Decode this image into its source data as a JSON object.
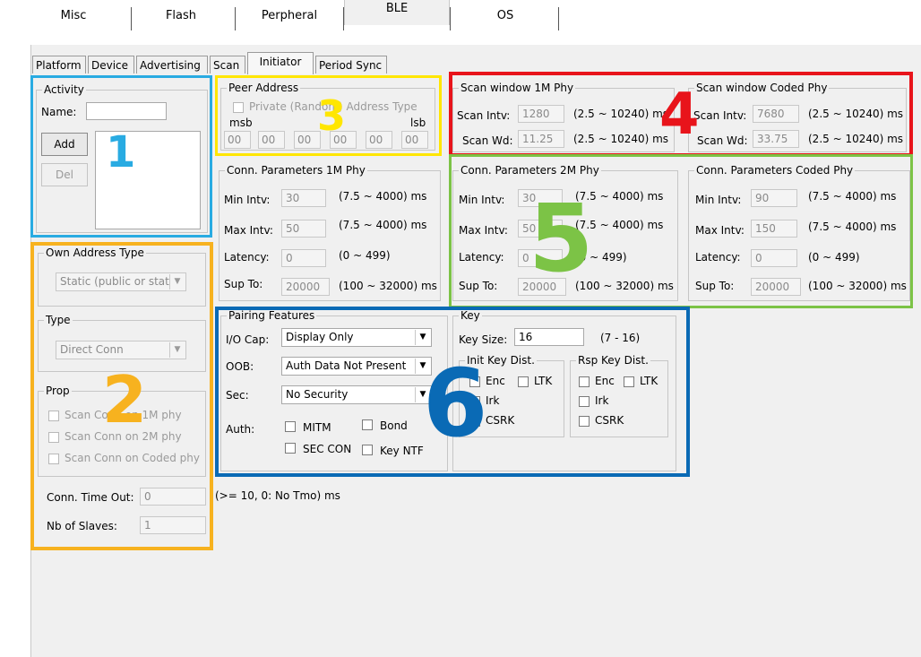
{
  "top_tabs": [
    "Misc",
    "Flash",
    "Perpheral",
    "BLE",
    "OS"
  ],
  "sub_tabs": [
    "Platform",
    "Device",
    "Advertising",
    "Scan",
    "Initiator",
    "Period Sync"
  ],
  "activity": {
    "legend": "Activity",
    "name_label": "Name:",
    "name_value": "",
    "add": "Add",
    "del": "Del"
  },
  "own_address": {
    "legend": "Own Address Type",
    "value": "Static (public or stat"
  },
  "type": {
    "legend": "Type",
    "value": "Direct Conn"
  },
  "prop": {
    "legend": "Prop",
    "items": [
      "Scan Conn on 1M phy",
      "Scan Conn on 2M phy",
      "Scan Conn on Coded phy"
    ]
  },
  "conn_timeout": {
    "label": "Conn. Time Out:",
    "value": "0",
    "unit": "(>= 10, 0: No Tmo) ms"
  },
  "nb_slaves": {
    "label": "Nb of Slaves:",
    "value": "1"
  },
  "peer": {
    "legend": "Peer Address",
    "checkbox": "Private (Random) Address Type",
    "msb": "msb",
    "lsb": "lsb",
    "bytes": [
      "00",
      "00",
      "00",
      "00",
      "00",
      "00"
    ]
  },
  "scan_1m": {
    "legend": "Scan window 1M Phy",
    "intv_label": "Scan Intv:",
    "intv": "1280",
    "intv_range": "(2.5 ~ 10240) ms",
    "wd_label": "Scan Wd:",
    "wd": "11.25",
    "wd_range": "(2.5 ~ 10240) ms"
  },
  "scan_coded": {
    "legend": "Scan window Coded Phy",
    "intv_label": "Scan Intv:",
    "intv": "7680",
    "intv_range": "(2.5 ~ 10240) ms",
    "wd_label": "Scan Wd:",
    "wd": "33.75",
    "wd_range": "(2.5 ~ 10240) ms"
  },
  "conn_groups": [
    {
      "legend": "Conn. Parameters 1M Phy",
      "min_label": "Min Intv:",
      "min": "30",
      "min_range": "(7.5 ~ 4000) ms",
      "max_label": "Max Intv:",
      "max": "50",
      "max_range": "(7.5 ~ 4000) ms",
      "lat_label": "Latency:",
      "lat": "0",
      "lat_range": "(0 ~ 499)",
      "sup_label": "Sup To:",
      "sup": "20000",
      "sup_range": "(100 ~ 32000) ms"
    },
    {
      "legend": "Conn. Parameters 2M Phy",
      "min_label": "Min Intv:",
      "min": "30",
      "min_range": "(7.5 ~ 4000) ms",
      "max_label": "Max Intv:",
      "max": "50",
      "max_range": "(7.5 ~ 4000) ms",
      "lat_label": "Latency:",
      "lat": "0",
      "lat_range": "(0 ~ 499)",
      "sup_label": "Sup To:",
      "sup": "20000",
      "sup_range": "(100 ~ 32000) ms"
    },
    {
      "legend": "Conn. Parameters Coded Phy",
      "min_label": "Min Intv:",
      "min": "90",
      "min_range": "(7.5 ~ 4000) ms",
      "max_label": "Max Intv:",
      "max": "150",
      "max_range": "(7.5 ~ 4000) ms",
      "lat_label": "Latency:",
      "lat": "0",
      "lat_range": "(0 ~ 499)",
      "sup_label": "Sup To:",
      "sup": "20000",
      "sup_range": "(100 ~ 32000) ms"
    }
  ],
  "pairing": {
    "legend": "Pairing Features",
    "io_label": "I/O Cap:",
    "io": "Display Only",
    "oob_label": "OOB:",
    "oob": "Auth Data Not Present",
    "sec_label": "Sec:",
    "sec": "No Security",
    "auth_label": "Auth:",
    "mitm": "MITM",
    "bond": "Bond",
    "sec_con": "SEC CON",
    "key_ntf": "Key NTF"
  },
  "key": {
    "legend": "Key",
    "size_label": "Key Size:",
    "size": "16",
    "size_range": "(7 - 16)",
    "init_legend": "Init Key Dist.",
    "rsp_legend": "Rsp Key Dist.",
    "enc": "Enc",
    "ltk": "LTK",
    "irk": "Irk",
    "csrk": "CSRK"
  },
  "annotations": {
    "numbers": [
      "1",
      "2",
      "3",
      "4",
      "5",
      "6"
    ],
    "colors": {
      "1": "#29abe2",
      "2": "#f7b21f",
      "3": "#ffe600",
      "4": "#e8141b",
      "5": "#7cc346",
      "6": "#0a6ab5"
    }
  }
}
